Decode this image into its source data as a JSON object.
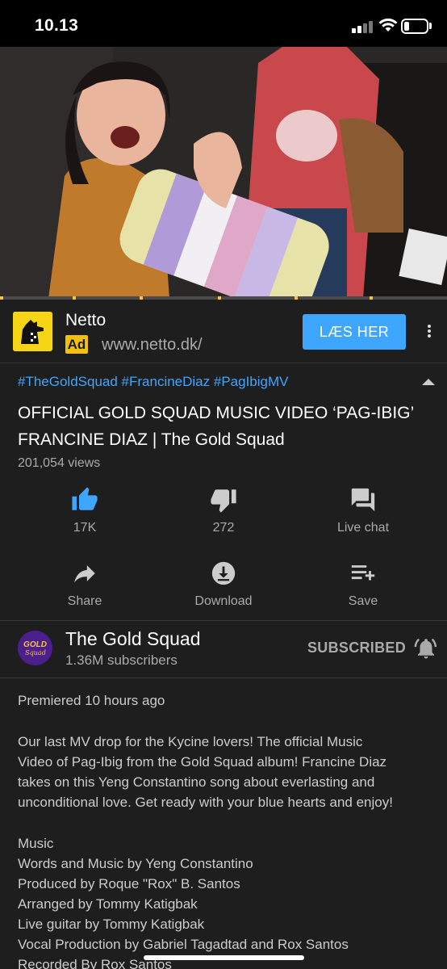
{
  "status_bar": {
    "time": "10.13"
  },
  "ad": {
    "name": "Netto",
    "badge": "Ad",
    "url": "www.netto.dk/",
    "cta": "LÆS HER",
    "logo_color": "#f5d515"
  },
  "video": {
    "hashtags": "#TheGoldSquad #FrancineDiaz #PagIbigMV",
    "title": "OFFICIAL GOLD SQUAD MUSIC VIDEO ‘PAG-IBIG’ FRANCINE DIAZ | The Gold Squad",
    "views": "201,054 views"
  },
  "actions": {
    "like": "17K",
    "dislike": "272",
    "live_chat": "Live chat",
    "share": "Share",
    "download": "Download",
    "save": "Save"
  },
  "channel": {
    "name": "The Gold Squad",
    "subscribers": "1.36M subscribers",
    "subscribe_state": "SUBSCRIBED",
    "avatar_text": "GOLD Squad"
  },
  "description": {
    "premiered": "Premiered 10 hours ago",
    "paragraph": [
      "Our last MV drop for the Kycine lovers! The official Music",
      "Video of Pag-Ibig from the Gold Squad album! Francine Diaz",
      "takes on this Yeng Constantino song about everlasting and",
      "unconditional love. Get ready with your blue hearts and enjoy!"
    ],
    "credits": [
      "Music",
      "Words and Music by Yeng Constantino",
      "Produced by Roque \"Rox\" B. Santos",
      "Arranged by Tommy Katigbak",
      "Live guitar by Tommy Katigbak",
      "Vocal Production by Gabriel Tagadtad and Rox Santos",
      "Recorded By Rox Santos"
    ]
  },
  "colors": {
    "accent_blue": "#3ea6ff",
    "background": "#1e1e1e",
    "secondary_text": "#aaaaaa"
  }
}
